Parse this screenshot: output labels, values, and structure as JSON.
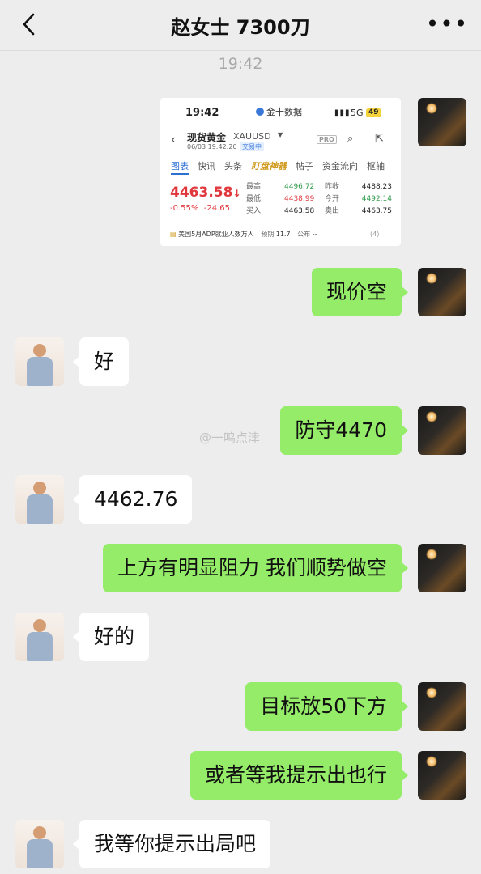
{
  "header": {
    "title": "赵女士  7300刀"
  },
  "timestamp": "19:42",
  "watermark": "@一鸣点津",
  "screenshot": {
    "status_time": "19:42",
    "app_name": "金十数据",
    "network": "5G",
    "battery": "49",
    "instrument_name": "现货黄金",
    "instrument_code": "XAUUSD",
    "datetime": "06/03 19:42:20",
    "trading_status": "交易中",
    "pro_badge": "PRO",
    "tabs": [
      "图表",
      "快讯",
      "头条",
      "盯盘神器",
      "帖子",
      "资金流向",
      "枢轴"
    ],
    "price": "4463.58",
    "price_arrow": "↓",
    "change_pct": "-0.55%",
    "change_abs": "-24.65",
    "stats": [
      {
        "k": "最高",
        "v": "4496.72",
        "k2": "昨收",
        "v2": "4488.23"
      },
      {
        "k": "最低",
        "v": "4438.99",
        "k2": "今开",
        "v2": "4492.14"
      },
      {
        "k": "买入",
        "v": "4463.58",
        "k2": "卖出",
        "v2": "4463.75"
      }
    ],
    "news": {
      "text": "美国5月ADP就业人数万人",
      "forecast_label": "预期",
      "forecast_value": "11.7",
      "publish_label": "公布",
      "publish_value": "--",
      "count": "(4)"
    }
  },
  "messages": [
    {
      "from": "me",
      "text": "现价空"
    },
    {
      "from": "her",
      "text": "好"
    },
    {
      "from": "me",
      "text": "防守4470"
    },
    {
      "from": "her",
      "text": "4462.76"
    },
    {
      "from": "me",
      "text": "上方有明显阻力 我们顺势做空"
    },
    {
      "from": "her",
      "text": "好的"
    },
    {
      "from": "me",
      "text": "目标放50下方"
    },
    {
      "from": "me",
      "text": "或者等我提示出也行"
    },
    {
      "from": "her",
      "text": "我等你提示出局吧"
    }
  ]
}
